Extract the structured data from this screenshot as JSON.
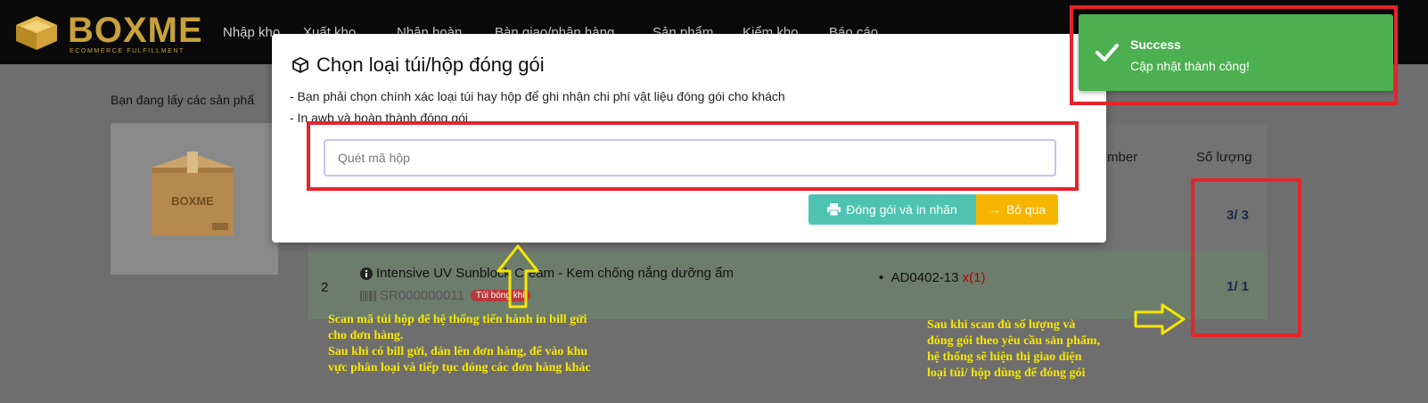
{
  "navbar": {
    "logo_text": "BOXME",
    "logo_sub": "ECOMMERCE FULFILLMENT",
    "items": [
      "Nhập kho",
      "Xuất kho",
      "Nhận hoàn",
      "Bàn giao/phân hàng",
      "Sản phẩm",
      "Kiểm kho",
      "Báo cáo"
    ]
  },
  "page": {
    "intro": "Bạn đang lấy các sản phẩ",
    "col_member": "mber",
    "col_qty": "Số lượng",
    "row1_qty": "3/ 3",
    "row2": {
      "index": "2",
      "product": "Intensive UV Sunblock Cream - Kem chống nắng dưỡng ẩm",
      "code": "SR000000011",
      "tag": "Túi bóng khí",
      "location": "AD0402-13",
      "location_count": "x(1)",
      "qty": "1/ 1"
    }
  },
  "modal": {
    "title": "Chọn loại túi/hộp đóng gói",
    "line1": "- Bạn phải chọn chính xác loại túi hay hộp để ghi nhận chi phí vật liệu đóng gói cho khách",
    "line2": "- In awb và hoàn thành đóng gói",
    "scan_placeholder": "Quét mã hộp",
    "btn_pack": "Đóng gói và in nhãn",
    "btn_skip": "Bỏ qua"
  },
  "toast": {
    "title": "Success",
    "message": "Cập nhật thành công!",
    "color": "#4caf50"
  },
  "annotations": {
    "left_1": "Scan mã túi hộp để hệ thống tiến hành in bill gửi",
    "left_2": "cho đơn hàng.",
    "left_3": "Sau khi có bill gửi, dán lên đơn hàng, để vào khu",
    "left_4": "vực phân loại và tiếp tục đóng các đơn hàng khác",
    "right_1": "Sau khi scan đủ số lượng và",
    "right_2": "đóng gói theo yêu cầu sản phẩm,",
    "right_3": "hệ thống sẽ hiện thị giao diện",
    "right_4": "loại túi/ hộp dùng để đóng gói",
    "color": "#f7e600",
    "highlight_color": "#e5242c"
  }
}
